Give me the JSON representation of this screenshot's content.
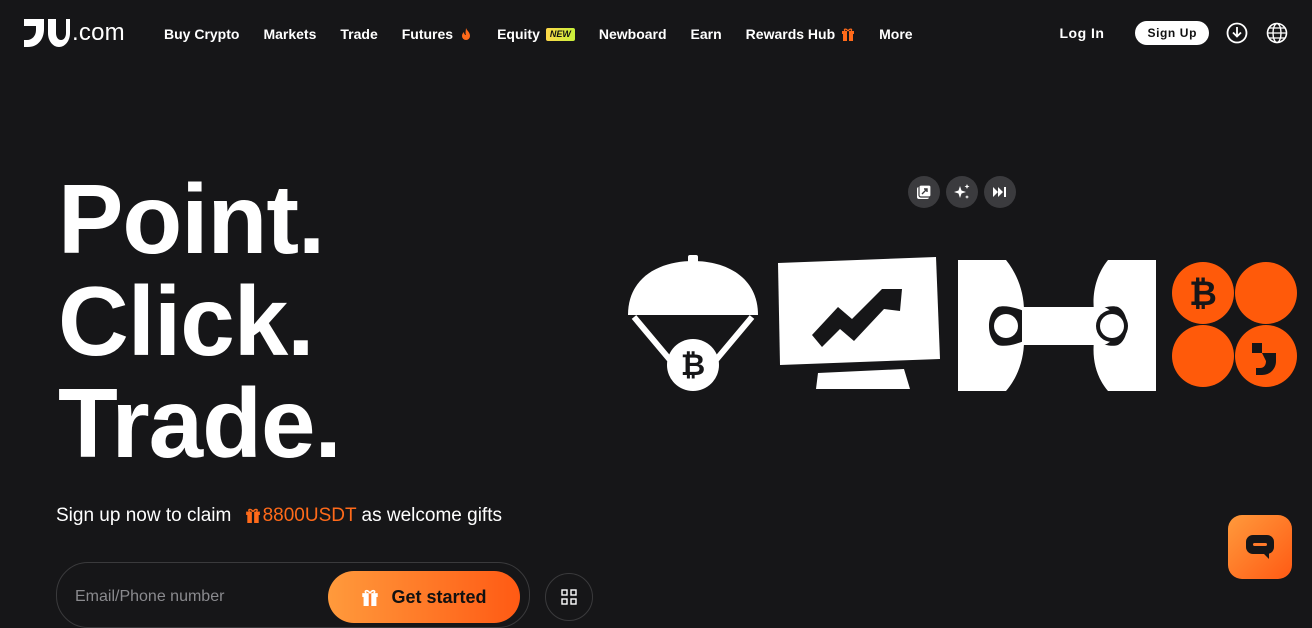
{
  "brand": {
    "logo_text": ".com",
    "accent": "#ff6a1a",
    "background": "#161618"
  },
  "nav": {
    "items": [
      {
        "label": "Buy Crypto"
      },
      {
        "label": "Markets"
      },
      {
        "label": "Trade"
      },
      {
        "label": "Futures",
        "icon": "fire-icon"
      },
      {
        "label": "Equity",
        "badge": "NEW"
      },
      {
        "label": "Newboard"
      },
      {
        "label": "Earn"
      },
      {
        "label": "Rewards Hub",
        "icon": "gift-icon"
      },
      {
        "label": "More"
      }
    ],
    "login_label": "Log In",
    "signup_label": "Sign Up",
    "icons": [
      "download-icon",
      "globe-icon"
    ]
  },
  "hero": {
    "lines": [
      "Point.",
      "Click.",
      "Trade."
    ],
    "sub_prefix": "Sign up now to claim",
    "sub_amount": "8800USDT",
    "sub_suffix": "as welcome gifts",
    "email_placeholder": "Email/Phone number",
    "cta_label": "Get started"
  },
  "media_controls": [
    "picture-in-picture-icon",
    "sparkle-icon",
    "skip-forward-icon"
  ],
  "illustration": [
    "parachute-bitcoin-icon",
    "chart-monitor-icon",
    "connector-icon",
    "coins-grid-icon"
  ]
}
